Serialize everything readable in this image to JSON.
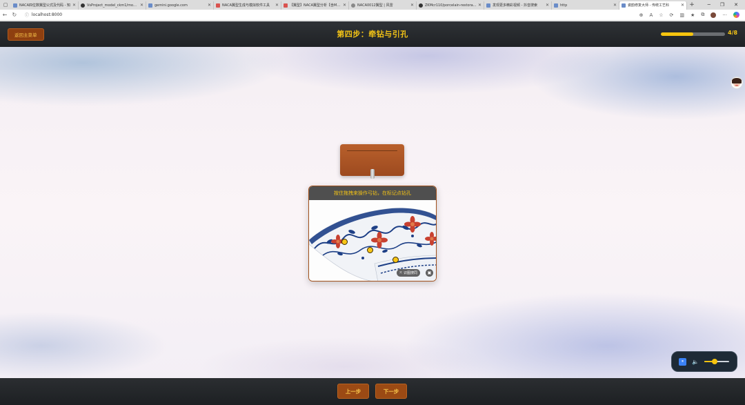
{
  "browser": {
    "tabs": [
      {
        "title": "NACA四位数翼型公式及代码 - 知",
        "favicon": "doc"
      },
      {
        "title": "VsProject_model_ckm1/model...",
        "favicon": "github"
      },
      {
        "title": "gemini.google.com",
        "favicon": "web"
      },
      {
        "title": "NACA翼型生成与模拟软件工具",
        "favicon": "red"
      },
      {
        "title": "【翼型】NACA翼型分析【含Ma...",
        "favicon": "red"
      },
      {
        "title": "NACA0012翼型 | 风雷",
        "favicon": "gray"
      },
      {
        "title": "ZKMcr110/porcelain-restoratio",
        "favicon": "github"
      },
      {
        "title": "发现更多精彩视频 - 抖音搜索",
        "favicon": "doc"
      },
      {
        "title": "http",
        "favicon": "web"
      },
      {
        "title": "瓷韵修复大师 - 传统工艺科",
        "favicon": "audio",
        "active": true
      }
    ],
    "new_tab_label": "+",
    "url": "localhost:8000"
  },
  "header": {
    "back_label": "返回主菜单",
    "step_title": "第四步：牵钻与引孔",
    "progress_text": "4/8",
    "progress_fraction": 0.5
  },
  "workspace": {
    "hint": "按住拖拽来操作弓钻，在标记点钻孔",
    "image_search_label": "识图搜同",
    "markers_count": 3
  },
  "footer": {
    "prev_label": "上一步",
    "next_label": "下一步"
  },
  "music": {
    "pause_glyph": "⏸",
    "volume_glyph": "🔈",
    "volume_fraction": 0.42
  },
  "colors": {
    "accent_gold": "#f3c316",
    "button_brown": "#9b4a14",
    "bar_dark": "#2a2d30"
  }
}
